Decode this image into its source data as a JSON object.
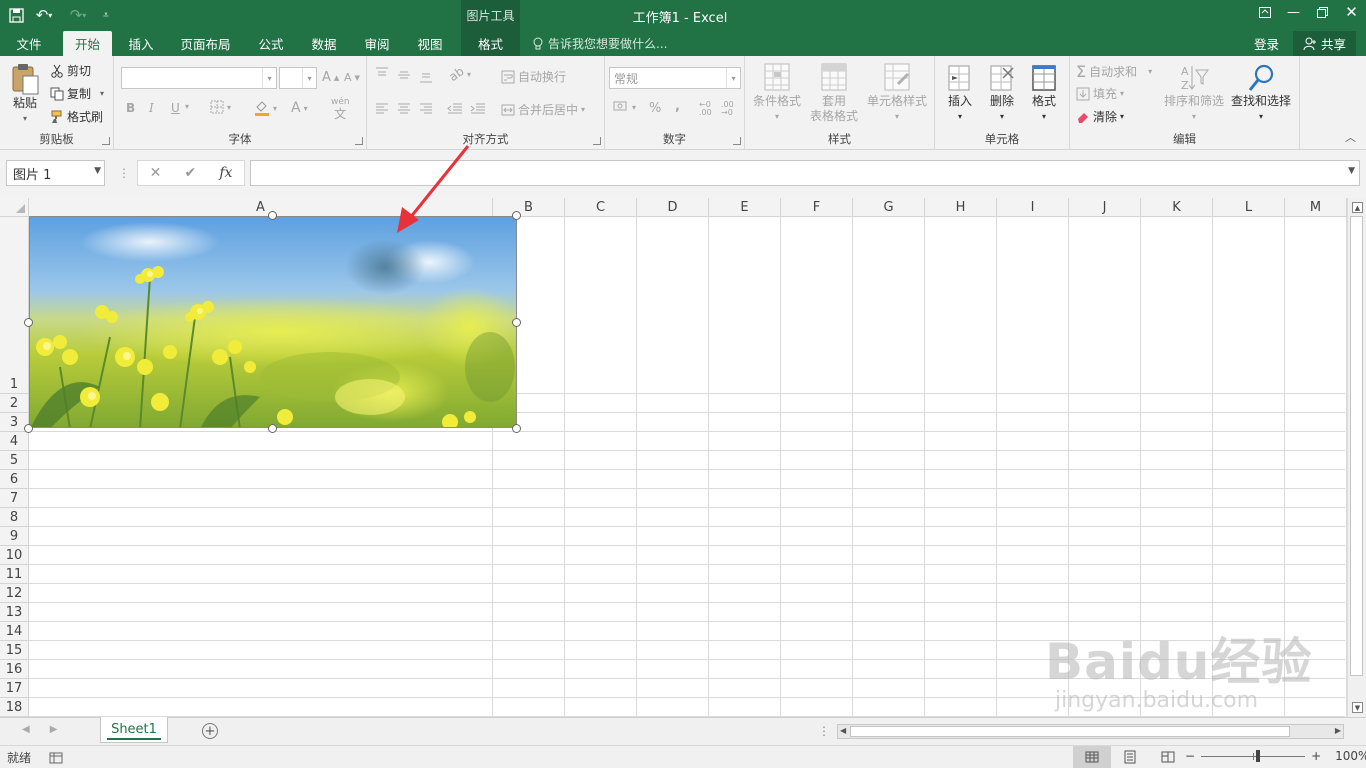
{
  "window": {
    "title": "工作簿1 - Excel",
    "context_group": "图片工具"
  },
  "qat": {
    "save_icon": "save-icon",
    "undo_icon": "undo-icon",
    "redo_icon": "redo-icon",
    "customize_icon": "customize-qat-icon"
  },
  "tabs": [
    {
      "label": "文件"
    },
    {
      "label": "开始"
    },
    {
      "label": "插入"
    },
    {
      "label": "页面布局"
    },
    {
      "label": "公式"
    },
    {
      "label": "数据"
    },
    {
      "label": "审阅"
    },
    {
      "label": "视图"
    },
    {
      "label": "格式"
    }
  ],
  "tellme": {
    "placeholder": "告诉我您想要做什么..."
  },
  "account": {
    "signin": "登录",
    "share": "共享"
  },
  "ribbon": {
    "clipboard": {
      "label": "剪贴板",
      "paste": "粘贴",
      "cut": "剪切",
      "copy": "复制",
      "format_painter": "格式刷"
    },
    "font": {
      "label": "字体",
      "bold": "B",
      "italic": "I",
      "underline": "U"
    },
    "alignment": {
      "label": "对齐方式",
      "wrap_text": "自动换行",
      "merge_center": "合并后居中"
    },
    "number": {
      "label": "数字",
      "format": "常规",
      "percent": "%",
      "comma": ","
    },
    "styles": {
      "label": "样式",
      "conditional": "条件格式",
      "table_line1": "套用",
      "table_line2": "表格格式",
      "cell_styles": "单元格样式"
    },
    "cells": {
      "label": "单元格",
      "insert": "插入",
      "delete": "删除",
      "format": "格式"
    },
    "editing": {
      "label": "编辑",
      "autosum": "自动求和",
      "fill": "填充",
      "clear": "清除",
      "sort_filter": "排序和筛选",
      "find_select": "查找和选择"
    }
  },
  "formula_bar": {
    "name_box": "图片 1",
    "fx": "fx",
    "value": ""
  },
  "grid": {
    "columns": [
      "A",
      "B",
      "C",
      "D",
      "E",
      "F",
      "G",
      "H",
      "I",
      "J",
      "K",
      "L",
      "M"
    ],
    "rows": [
      "1",
      "2",
      "3",
      "4",
      "5",
      "6",
      "7",
      "8",
      "9",
      "10",
      "11",
      "12",
      "13",
      "14",
      "15",
      "16",
      "17",
      "18"
    ]
  },
  "picture": {
    "name": "图片 1",
    "description_icon": "photo-yellow-flowers-icon"
  },
  "sheet_tabs": {
    "active": "Sheet1"
  },
  "status": {
    "ready": "就绪",
    "zoom": "100%"
  },
  "watermark": {
    "logo": "Baidu经验",
    "url": "jingyan.baidu.com"
  },
  "colors": {
    "excel_green": "#217346",
    "arrow_red": "#e8323a"
  }
}
